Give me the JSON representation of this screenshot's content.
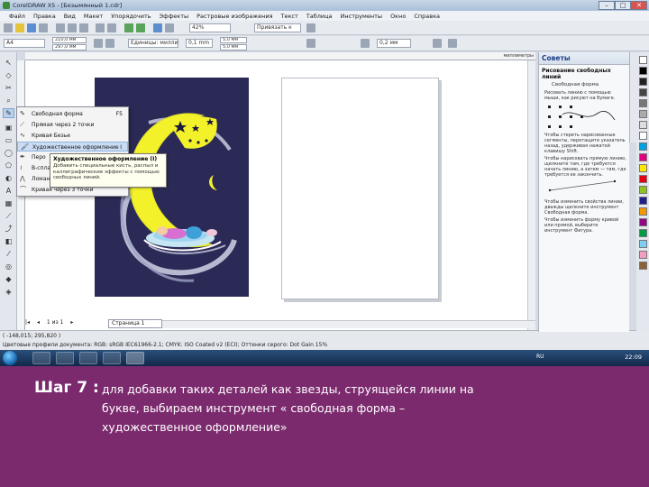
{
  "window": {
    "title": "CorelDRAW X5 - [Безымянный 1.cdr]",
    "controls": [
      "–",
      "□",
      "✕"
    ]
  },
  "menu": [
    "Файл",
    "Правка",
    "Вид",
    "Макет",
    "Упорядочить",
    "Эффекты",
    "Растровые изображения",
    "Текст",
    "Таблица",
    "Инструменты",
    "Окно",
    "Справка"
  ],
  "toolbar": {
    "paper": "A4",
    "width": "210,0 мм",
    "height": "297,0 мм",
    "units": "Единицы: миллиметры",
    "zoom": "42%",
    "snap": "Привязать к",
    "nudge": "0,1 mm",
    "duplicate_x": "5,0 мм",
    "duplicate_y": "5,0 мм",
    "outline_width": "0,2 мм"
  },
  "ruler": {
    "unit": "миллиметры"
  },
  "flyout": {
    "items": [
      {
        "label": "Свободная форма",
        "key": "F5"
      },
      {
        "label": "Прямая через 2 точки",
        "key": ""
      },
      {
        "label": "Кривая Безье",
        "key": ""
      },
      {
        "label": "Художественное оформление",
        "key": "I"
      },
      {
        "label": "Перо",
        "key": ""
      },
      {
        "label": "В-сплайн",
        "key": ""
      },
      {
        "label": "Ломаная линия",
        "key": ""
      },
      {
        "label": "Кривая через 3 точки",
        "key": ""
      }
    ]
  },
  "tooltip": {
    "title": "Художественное оформление (I)",
    "body": "Добавить специальные кисть, распыл и каллиграфические эффекты с помощью свободных линий."
  },
  "pages": {
    "nav": "1 из 1",
    "tab": "Страница 1"
  },
  "status": {
    "coords": "( -148,015; 295,820 )",
    "profile": "Цветовые профили документа: RGB: sRGB IEC61966-2.1; CMYK: ISO Coated v2 (ECI); Оттенки серого: Dot Gain 15%"
  },
  "docker": {
    "title": "Советы",
    "subtitle": "Рисование свободных линий",
    "tool": "Свободная форма",
    "tips": [
      "Рисовать линию с помощью мыши, как рисуют на бумаге.",
      "Чтобы стереть нарисованные сегменты, перетащите указатель назад, удерживая нажатой клавишу Shift.",
      "Чтобы нарисовать прямую линию, щелкните там, где требуется начать линию, а затем — там, где требуется ее закончить.",
      "Чтобы изменить свойства линии, дважды щелкните инструмент Свободная форма.",
      "Чтобы изменить форму кривой или прямой, выберите инструмент Фигура."
    ]
  },
  "taskbar": {
    "lang": "RU",
    "time": "22:09"
  },
  "caption": {
    "step": "Шаг 7 :",
    "line1": "для добавки таких деталей как звезды, струящейся линии на",
    "line2": "букве, выбираем инструмент « свободная форма –",
    "line3": "художественное оформление»"
  },
  "colors": {
    "slide_bg": "#7b2a6e",
    "art_bg": "#2b2a57",
    "moon": "#f3f12a",
    "docker_title": "#1d3f86"
  }
}
